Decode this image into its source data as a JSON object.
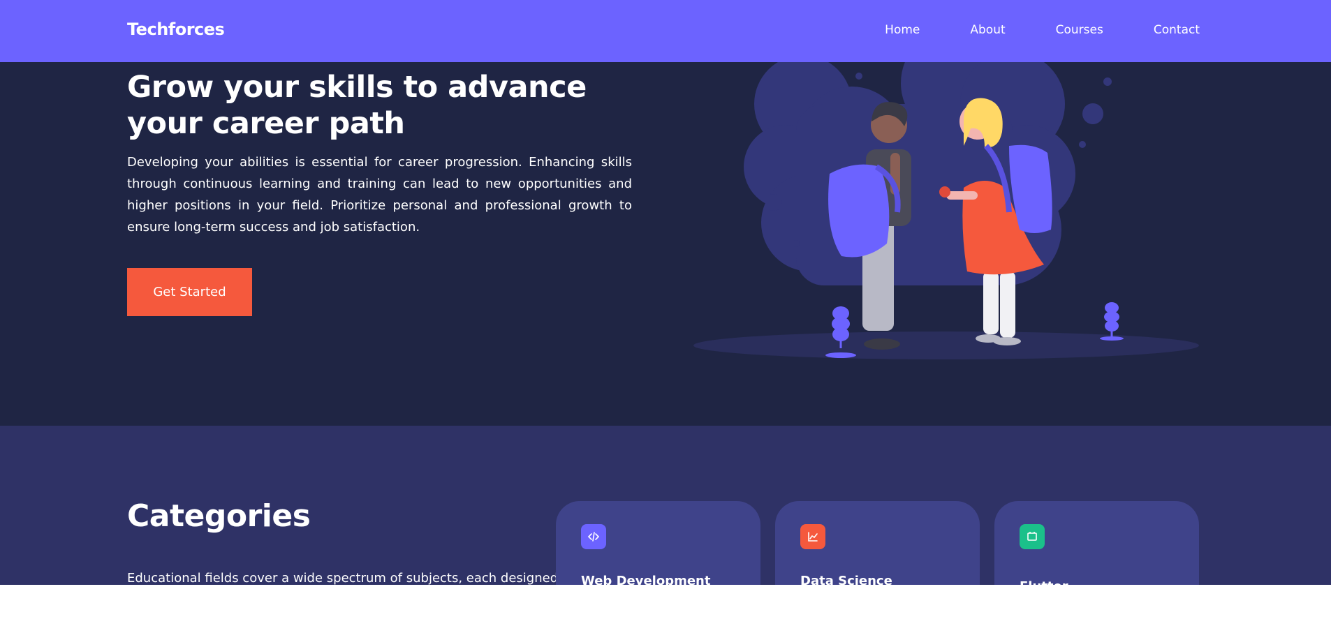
{
  "brand": "Techforces",
  "nav": {
    "items": [
      "Home",
      "About",
      "Courses",
      "Contact"
    ]
  },
  "hero": {
    "title_line1": "Grow your skills to advance",
    "title_line2": "your career path",
    "description": "Developing your abilities is essential for career progression. Enhancing skills through continuous learning and training can lead to new opportunities and higher positions in your field. Prioritize personal and professional growth to ensure long-term success and job satisfaction.",
    "cta_label": "Get Started"
  },
  "categories": {
    "title": "Categories",
    "description": "Educational fields cover a wide spectrum of subjects, each designed",
    "cards": [
      {
        "title": "Web Development",
        "icon": "code-icon",
        "color": "#6c63ff"
      },
      {
        "title": "Data Science",
        "icon": "chart-icon",
        "color": "#f5593d"
      },
      {
        "title": "Flutter",
        "icon": "mobile-icon",
        "color": "#1bc08a"
      }
    ]
  },
  "colors": {
    "navbar": "#6c63ff",
    "hero_bg": "#1f2544",
    "categories_bg": "#2f3266",
    "card_bg": "#3f438a",
    "accent": "#f5593d"
  }
}
